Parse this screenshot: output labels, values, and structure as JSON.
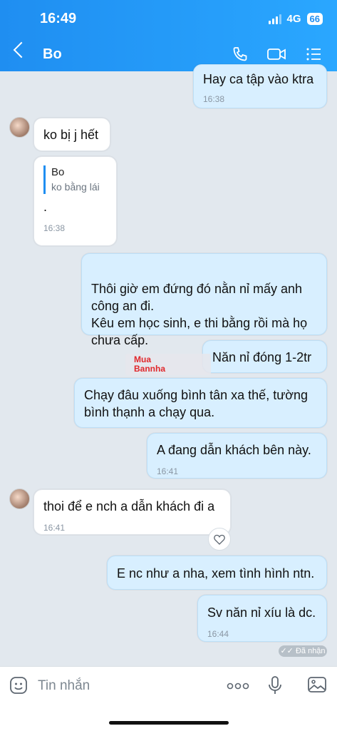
{
  "status": {
    "time": "16:49",
    "network": "4G",
    "battery": "66"
  },
  "header": {
    "contact": "Bo"
  },
  "messages": [
    {
      "dir": "sent",
      "text": "Hay ca tập vào ktra",
      "time": "16:38"
    },
    {
      "dir": "recv",
      "text": "ko bị j hết"
    },
    {
      "dir": "recv",
      "quote_name": "Bo",
      "quote_text": "ko bằng lái",
      "text": ".",
      "time": "16:38"
    },
    {
      "dir": "sent",
      "text": "Thôi giờ em đứng đó nằn nỉ mấy anh công an đi.\nKêu em học sinh, e thi bằng rồi mà họ chưa cấp."
    },
    {
      "dir": "sent",
      "text": "Năn nỉ đóng 1-2tr"
    },
    {
      "dir": "sent",
      "text": "Chạy đâu xuống bình tân xa thế, tường bình thạnh a chạy qua."
    },
    {
      "dir": "sent",
      "text": "A đang dẫn khách bên này.",
      "time": "16:41"
    },
    {
      "dir": "recv",
      "text": "thoi để e nch a dẫn khách đi a",
      "time": "16:41"
    },
    {
      "dir": "sent",
      "text": "E nc như a nha, xem tình hình ntn."
    },
    {
      "dir": "sent",
      "text": "Sv năn nỉ xíu là dc.",
      "time": "16:44"
    }
  ],
  "seen_label": "Đã nhận",
  "watermark": {
    "line1": "Mua",
    "line2": "Bannha"
  },
  "footer": {
    "placeholder": "Tin nhắn"
  }
}
